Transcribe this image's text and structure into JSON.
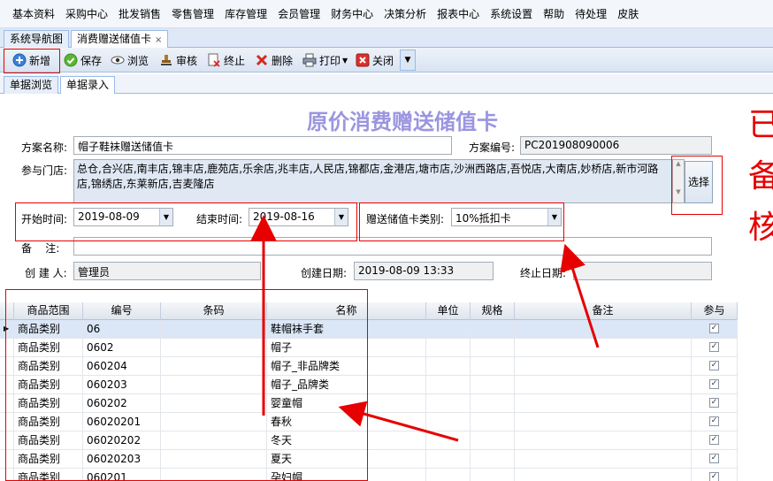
{
  "menu": [
    "基本资料",
    "采购中心",
    "批发销售",
    "零售管理",
    "库存管理",
    "会员管理",
    "财务中心",
    "决策分析",
    "报表中心",
    "系统设置",
    "帮助",
    "待处理",
    "皮肤"
  ],
  "doc_tabs": [
    "系统导航图",
    "消费赠送储值卡"
  ],
  "close_glyph": "×",
  "toolbar": {
    "new": "新增",
    "save": "保存",
    "browse": "浏览",
    "audit": "审核",
    "stop": "终止",
    "delete": "删除",
    "print": "打印",
    "close": "关闭"
  },
  "sub_tabs": [
    "单据浏览",
    "单据录入"
  ],
  "form": {
    "title": "原价消费赠送储值卡",
    "plan_name_label": "方案名称:",
    "plan_name": "帽子鞋袜赠送储值卡",
    "plan_no_label": "方案编号:",
    "plan_no": "PC201908090006",
    "stores_label": "参与门店:",
    "stores": "总仓,合兴店,南丰店,锦丰店,鹿苑店,乐余店,兆丰店,人民店,锦都店,金港店,塘市店,沙洲西路店,吾悦店,大南店,妙桥店,新市河路店,锦绣店,东莱新店,吉麦隆店",
    "select_button": "选择",
    "start_label": "开始时间:",
    "start_date": "2019-08-09",
    "end_label": "结束时间:",
    "end_date": "2019-08-16",
    "card_type_label": "赠送储值卡类别:",
    "card_type": "10%抵扣卡",
    "remark_label": "备    注:",
    "remark": "",
    "creator_label": "创 建 人:",
    "creator": "管理员",
    "create_date_label": "创建日期:",
    "create_date": "2019-08-09 13:33",
    "end_date_label": "终止日期:",
    "stop_date": ""
  },
  "annotation_text": "已\n备\n核",
  "grid": {
    "columns": [
      "商品范围",
      "编号",
      "条码",
      "名称",
      "单位",
      "规格",
      "备注",
      "参与"
    ],
    "rows": [
      {
        "scope": "商品类别",
        "code": "06",
        "barcode": "",
        "name": "鞋帽袜手套",
        "unit": "",
        "spec": "",
        "note": "",
        "join": "✓"
      },
      {
        "scope": "商品类别",
        "code": "0602",
        "barcode": "",
        "name": "帽子",
        "unit": "",
        "spec": "",
        "note": "",
        "join": "✓"
      },
      {
        "scope": "商品类别",
        "code": "060204",
        "barcode": "",
        "name": "帽子_非品牌类",
        "unit": "",
        "spec": "",
        "note": "",
        "join": "✓"
      },
      {
        "scope": "商品类别",
        "code": "060203",
        "barcode": "",
        "name": "帽子_品牌类",
        "unit": "",
        "spec": "",
        "note": "",
        "join": "✓"
      },
      {
        "scope": "商品类别",
        "code": "060202",
        "barcode": "",
        "name": "婴童帽",
        "unit": "",
        "spec": "",
        "note": "",
        "join": "✓"
      },
      {
        "scope": "商品类别",
        "code": "06020201",
        "barcode": "",
        "name": "春秋",
        "unit": "",
        "spec": "",
        "note": "",
        "join": "✓"
      },
      {
        "scope": "商品类别",
        "code": "06020202",
        "barcode": "",
        "name": "冬天",
        "unit": "",
        "spec": "",
        "note": "",
        "join": "✓"
      },
      {
        "scope": "商品类别",
        "code": "06020203",
        "barcode": "",
        "name": "夏天",
        "unit": "",
        "spec": "",
        "note": "",
        "join": "✓"
      },
      {
        "scope": "商品类别",
        "code": "060201",
        "barcode": "",
        "name": "孕妇帽",
        "unit": "",
        "spec": "",
        "note": "",
        "join": "✓"
      }
    ]
  },
  "colors": {
    "annotation_red": "#e60000",
    "title_purple": "#9b95e0",
    "selected_row": "#dbe7f7"
  }
}
